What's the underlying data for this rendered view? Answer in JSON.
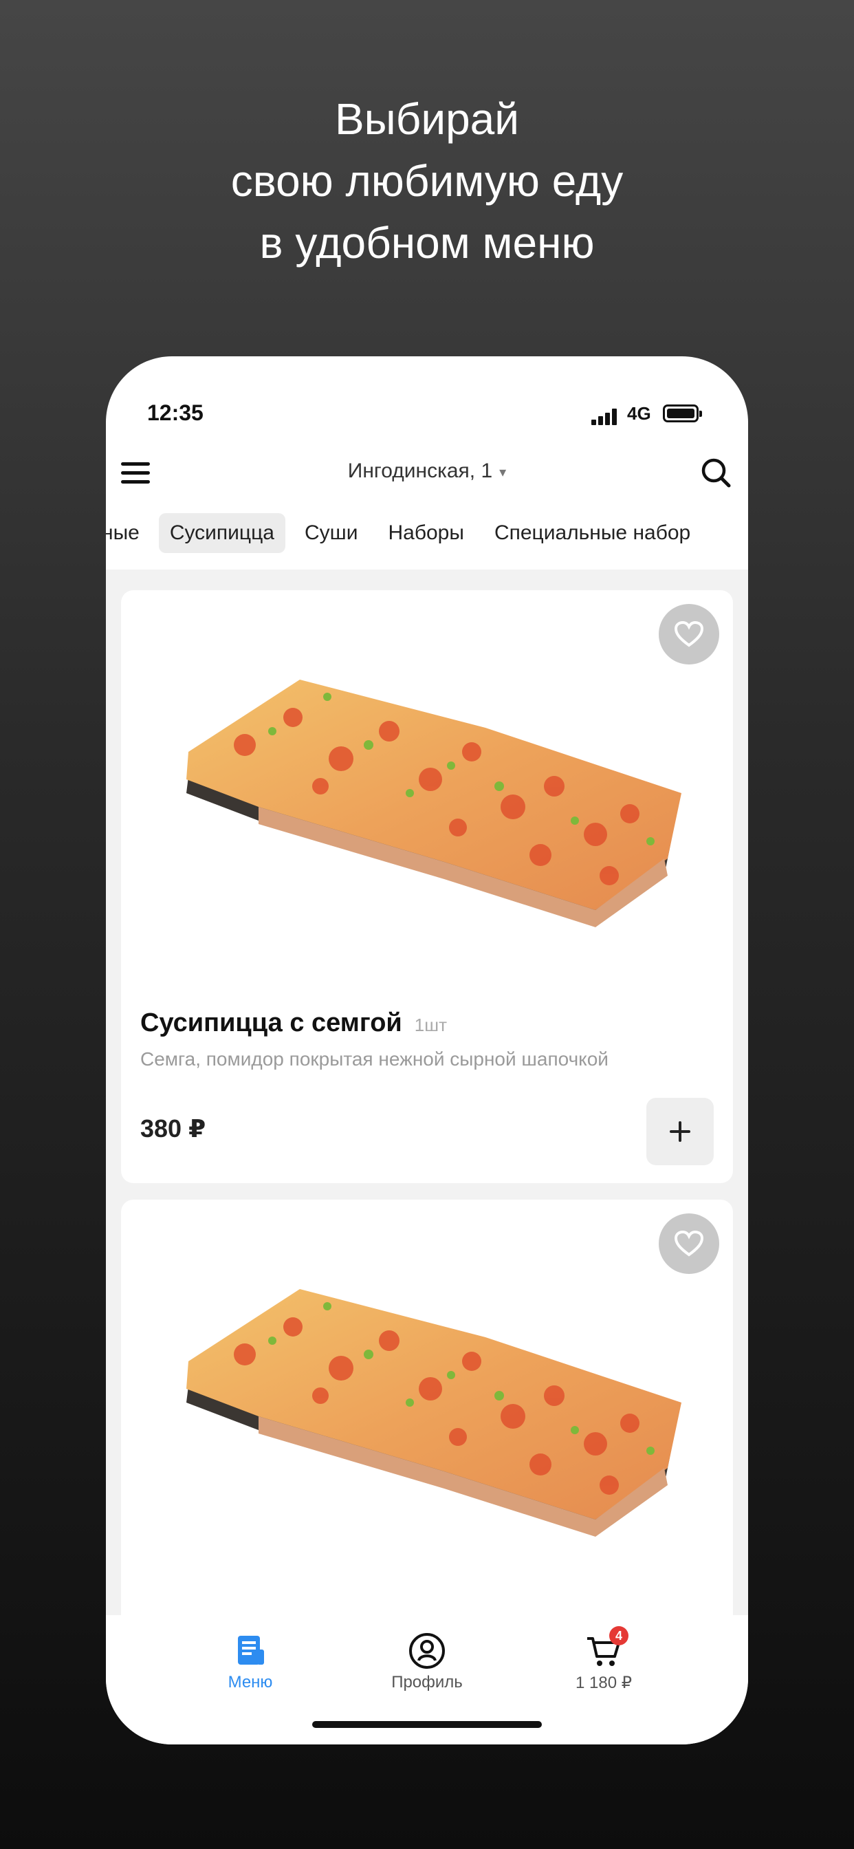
{
  "promo": {
    "line1": "Выбирай",
    "line2": "свою любимую еду",
    "line3": "в удобном меню"
  },
  "status_bar": {
    "time": "12:35",
    "network": "4G"
  },
  "header": {
    "address": "Ингодинская, 1",
    "menu_icon": "hamburger-icon",
    "search_icon": "search-icon"
  },
  "categories": {
    "items": [
      "ные",
      "Сусипицца",
      "Суши",
      "Наборы",
      "Специальные набор"
    ],
    "active": "Сусипицца"
  },
  "products": [
    {
      "title": "Сусипицца с семгой",
      "qty": "1шт",
      "description": "Семга, помидор покрытая нежной сырной шапочкой",
      "price": "380 ₽"
    },
    {
      "title": "",
      "qty": "",
      "description": "",
      "price": ""
    }
  ],
  "tabbar": {
    "menu_label": "Меню",
    "profile_label": "Профиль",
    "cart_label": "1 180 ₽",
    "cart_badge": "4",
    "accent": "#2d8cf0"
  }
}
